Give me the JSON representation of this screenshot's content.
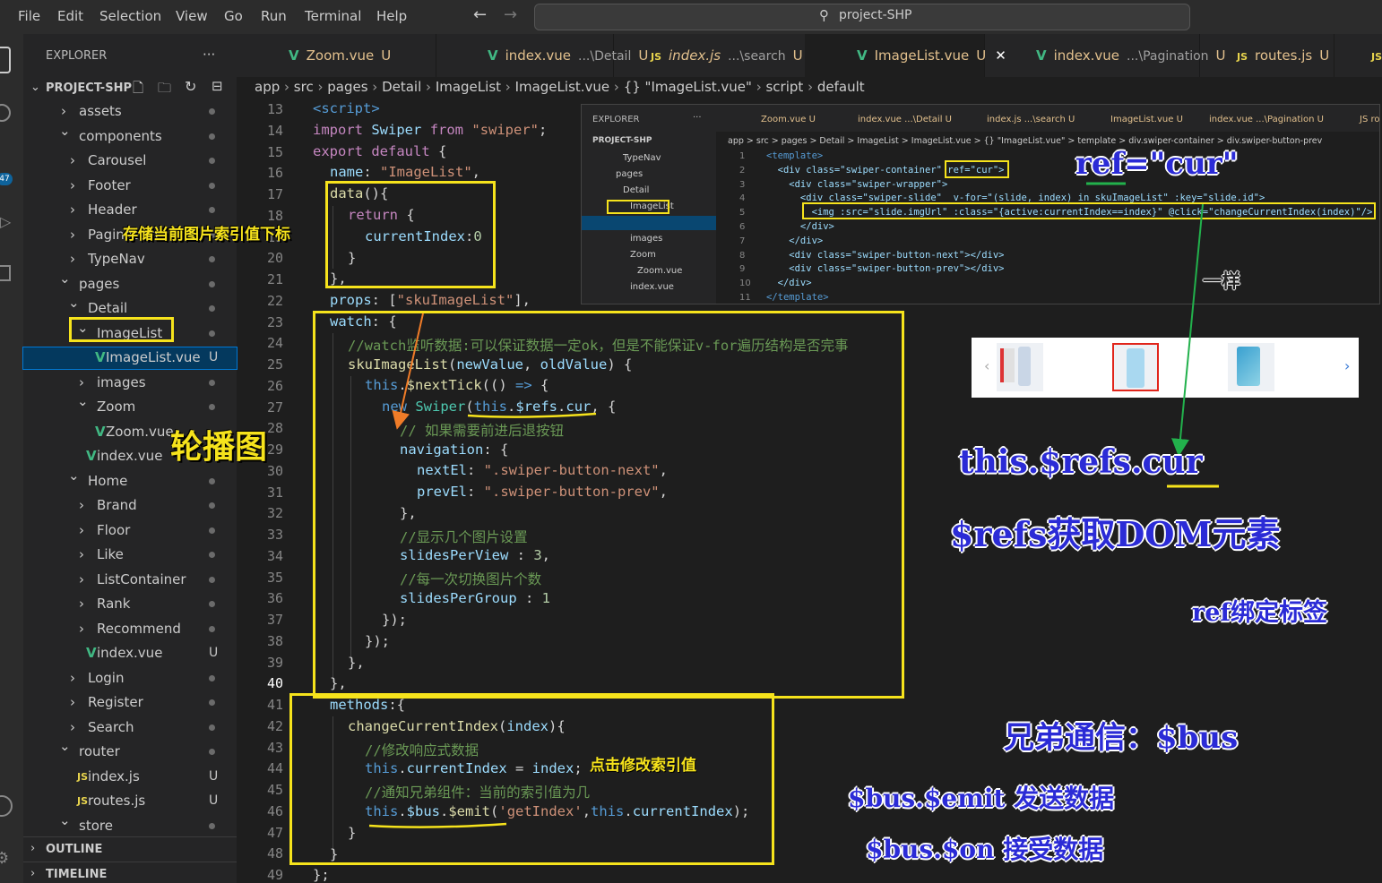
{
  "menu": [
    "File",
    "Edit",
    "Selection",
    "View",
    "Go",
    "Run",
    "Terminal",
    "Help"
  ],
  "search": {
    "text": "project-SHP"
  },
  "activity_badge": "47",
  "explorer": {
    "title": "EXPLORER",
    "more": "···",
    "project": "PROJECT-SHP",
    "items": [
      {
        "label": "assets",
        "type": "folder-closed"
      },
      {
        "label": "components",
        "type": "folder-open"
      },
      {
        "label": "Carousel",
        "type": "folder-closed"
      },
      {
        "label": "Footer",
        "type": "folder-closed"
      },
      {
        "label": "Header",
        "type": "folder-closed"
      },
      {
        "label": "Pagination",
        "type": "folder-closed"
      },
      {
        "label": "TypeNav",
        "type": "folder-closed"
      },
      {
        "label": "pages",
        "type": "folder-open"
      },
      {
        "label": "Detail",
        "type": "folder-open"
      },
      {
        "label": "ImageList",
        "type": "folder-open"
      },
      {
        "label": "ImageList.vue",
        "type": "vue",
        "badge": "U"
      },
      {
        "label": "images",
        "type": "folder-closed"
      },
      {
        "label": "Zoom",
        "type": "folder-open"
      },
      {
        "label": "Zoom.vue",
        "type": "vue"
      },
      {
        "label": "index.vue",
        "type": "vue"
      },
      {
        "label": "Home",
        "type": "folder-open"
      },
      {
        "label": "Brand",
        "type": "folder-closed"
      },
      {
        "label": "Floor",
        "type": "folder-closed"
      },
      {
        "label": "Like",
        "type": "folder-closed"
      },
      {
        "label": "ListContainer",
        "type": "folder-closed"
      },
      {
        "label": "Rank",
        "type": "folder-closed"
      },
      {
        "label": "Recommend",
        "type": "folder-closed"
      },
      {
        "label": "index.vue",
        "type": "vue",
        "badge": "U"
      },
      {
        "label": "Login",
        "type": "folder-closed"
      },
      {
        "label": "Register",
        "type": "folder-closed"
      },
      {
        "label": "Search",
        "type": "folder-closed"
      },
      {
        "label": "router",
        "type": "folder-open"
      },
      {
        "label": "index.js",
        "type": "js",
        "badge": "U"
      },
      {
        "label": "routes.js",
        "type": "js",
        "badge": "U"
      },
      {
        "label": "store",
        "type": "folder-open"
      }
    ],
    "outline": "OUTLINE",
    "timeline": "TIMELINE"
  },
  "tabs": [
    {
      "icon": "V",
      "name": "Zoom.vue",
      "desc": "",
      "badge": "U"
    },
    {
      "icon": "V",
      "name": "index.vue",
      "desc": "...\\Detail",
      "badge": "U"
    },
    {
      "icon": "JS",
      "name": "index.js",
      "desc": "...\\search",
      "badge": "U"
    },
    {
      "icon": "V",
      "name": "ImageList.vue",
      "desc": "",
      "badge": "U",
      "close": "✕"
    },
    {
      "icon": "V",
      "name": "index.vue",
      "desc": "...\\Pagination",
      "badge": "U"
    },
    {
      "icon": "JS",
      "name": "routes.js",
      "desc": "",
      "badge": "U"
    },
    {
      "icon": "JS",
      "name": "in",
      "desc": "",
      "badge": ""
    }
  ],
  "breadcrumb": [
    "app",
    "src",
    "pages",
    "Detail",
    "ImageList",
    "ImageList.vue",
    "{} \"ImageList.vue\"",
    "script",
    "default"
  ],
  "line_numbers": [
    "13",
    "14",
    "15",
    "16",
    "17",
    "18",
    "19",
    "20",
    "21",
    "22",
    "23",
    "24",
    "25",
    "26",
    "27",
    "28",
    "29",
    "30",
    "31",
    "32",
    "33",
    "34",
    "35",
    "36",
    "37",
    "38",
    "39",
    "40",
    "41",
    "42",
    "43",
    "44",
    "45",
    "46",
    "47",
    "48",
    "49"
  ],
  "code": {
    "l13": "<script>",
    "l14a": "import",
    "l14b": "Swiper",
    "l14c": "from",
    "l14d": "\"swiper\"",
    "l15a": "export",
    "l15b": "default",
    "l16a": "name",
    "l16b": "\"ImageList\"",
    "l17a": "data",
    "l18a": "return",
    "l19a": "currentIndex",
    "l19b": "0",
    "l22a": "props",
    "l22b": "\"skuImageList\"",
    "l23a": "watch",
    "l24": "//watch监听数据:可以保证数据一定ok，但是不能保证v-for遍历结构是否完事",
    "l25a": "skuImageList",
    "l25b": "newValue",
    "l25c": "oldValue",
    "l26a": "this",
    "l26b": "$nextTick",
    "l27a": "new",
    "l27b": "Swiper",
    "l27c": "this",
    "l27d": "$refs",
    "l27e": "cur",
    "l28": "// 如果需要前进后退按钮",
    "l29a": "navigation",
    "l30a": "nextEl",
    "l30b": "\".swiper-button-next\"",
    "l31a": "prevEl",
    "l31b": "\".swiper-button-prev\"",
    "l33": "//显示几个图片设置",
    "l34a": "slidesPerView",
    "l34b": "3",
    "l35": "//每一次切换图片个数",
    "l36a": "slidesPerGroup",
    "l36b": "1",
    "l41a": "methods",
    "l42a": "changeCurrentIndex",
    "l42b": "index",
    "l43": "//修改响应式数据",
    "l44a": "this",
    "l44b": "currentIndex",
    "l44c": "index",
    "l45": "//通知兄弟组件：当前的索引值为几",
    "l46a": "this",
    "l46b": "$bus",
    "l46c": "$emit",
    "l46d": "'getIndex'",
    "l46e": "this",
    "l46f": "currentIndex"
  },
  "inset": {
    "explorer": "EXPLORER",
    "project": "PROJECT-SHP",
    "tree": [
      "TypeNav",
      "pages",
      "Detail",
      "ImageList",
      "ImageList.vue",
      "images",
      "Zoom",
      "Zoom.vue",
      "index.vue"
    ],
    "tabs": [
      "Zoom.vue U",
      "index.vue ...\\Detail U",
      "index.js ...\\search U",
      "ImageList.vue U",
      "index.vue ...\\Pagination U",
      "JS ro"
    ],
    "crumbs": "app > src > pages > Detail > ImageList > ImageList.vue > {} \"ImageList.vue\" > template > div.swiper-container > div.swiper-button-prev",
    "lines": [
      "1",
      "2",
      "3",
      "4",
      "5",
      "6",
      "7",
      "8",
      "9",
      "10",
      "11"
    ],
    "code": [
      "<template>",
      "  <div class=\"swiper-container\" ref=\"cur\">",
      "    <div class=\"swiper-wrapper\">",
      "      <div class=\"swiper-slide\"  v-for=\"(slide, index) in skuImageList\" :key=\"slide.id\">",
      "        <img :src=\"slide.imgUrl\" :class=\"{active:currentIndex==index}\" @click=\"changeCurrentIndex(index)\"/>",
      "      </div>",
      "    </div>",
      "    <div class=\"swiper-button-next\"></div>",
      "    <div class=\"swiper-button-prev\"></div>",
      "  </div>",
      "</template>"
    ]
  },
  "annotations": {
    "index_note": "存储当前图片索引值下标",
    "carousel": "轮播图",
    "ref_cur": "ref=\"cur\"",
    "same": "一样",
    "this_refs": "this.$refs.cur",
    "refs_dom": "$refs获取DOM元素",
    "ref_bind": "ref绑定标签",
    "click_note": "点击修改索引值",
    "sibling": "兄弟通信：$bus",
    "emit": "$bus.$emit 发送数据",
    "on": "$bus.$on 接受数据"
  },
  "colors": {
    "annotation_box": "#f6e31c",
    "arrow_green": "#22b14c",
    "arrow_orange": "#f07c28",
    "blue_text": "#2b2bd6"
  }
}
